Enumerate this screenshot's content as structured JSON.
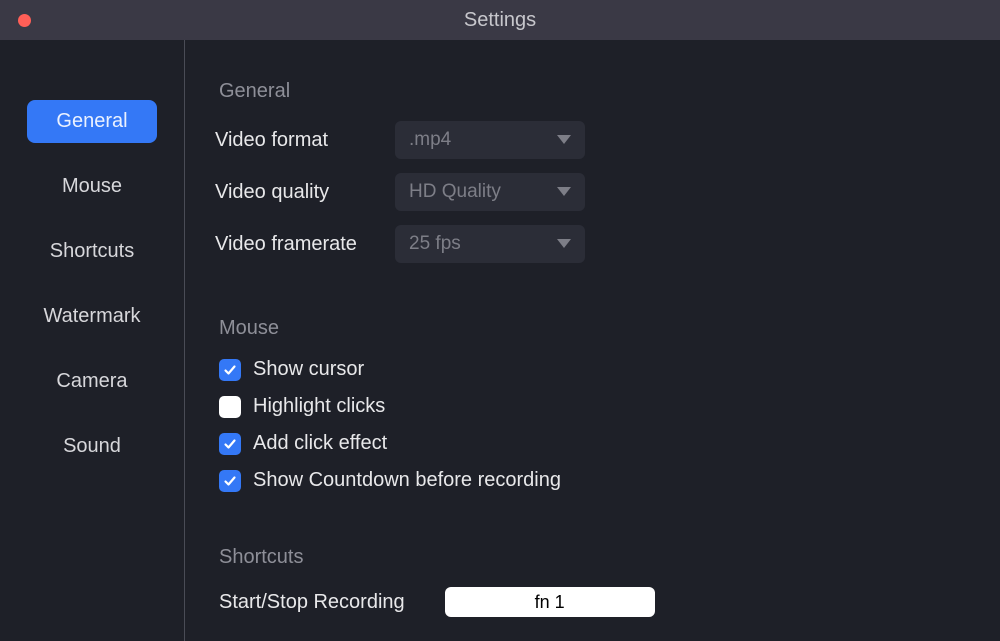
{
  "window": {
    "title": "Settings"
  },
  "sidebar": {
    "items": [
      {
        "label": "General",
        "active": true
      },
      {
        "label": "Mouse",
        "active": false
      },
      {
        "label": "Shortcuts",
        "active": false
      },
      {
        "label": "Watermark",
        "active": false
      },
      {
        "label": "Camera",
        "active": false
      },
      {
        "label": "Sound",
        "active": false
      }
    ]
  },
  "general": {
    "heading": "General",
    "video_format": {
      "label": "Video format",
      "value": ".mp4"
    },
    "video_quality": {
      "label": "Video quality",
      "value": "HD Quality"
    },
    "video_framerate": {
      "label": "Video framerate",
      "value": "25 fps"
    }
  },
  "mouse": {
    "heading": "Mouse",
    "show_cursor": {
      "label": "Show cursor",
      "checked": true
    },
    "highlight_clicks": {
      "label": "Highlight clicks",
      "checked": false
    },
    "add_click_effect": {
      "label": "Add click effect",
      "checked": true
    },
    "show_countdown": {
      "label": "Show Countdown before recording",
      "checked": true
    }
  },
  "shortcuts": {
    "heading": "Shortcuts",
    "start_stop": {
      "label": "Start/Stop Recording",
      "value": "fn 1"
    }
  }
}
